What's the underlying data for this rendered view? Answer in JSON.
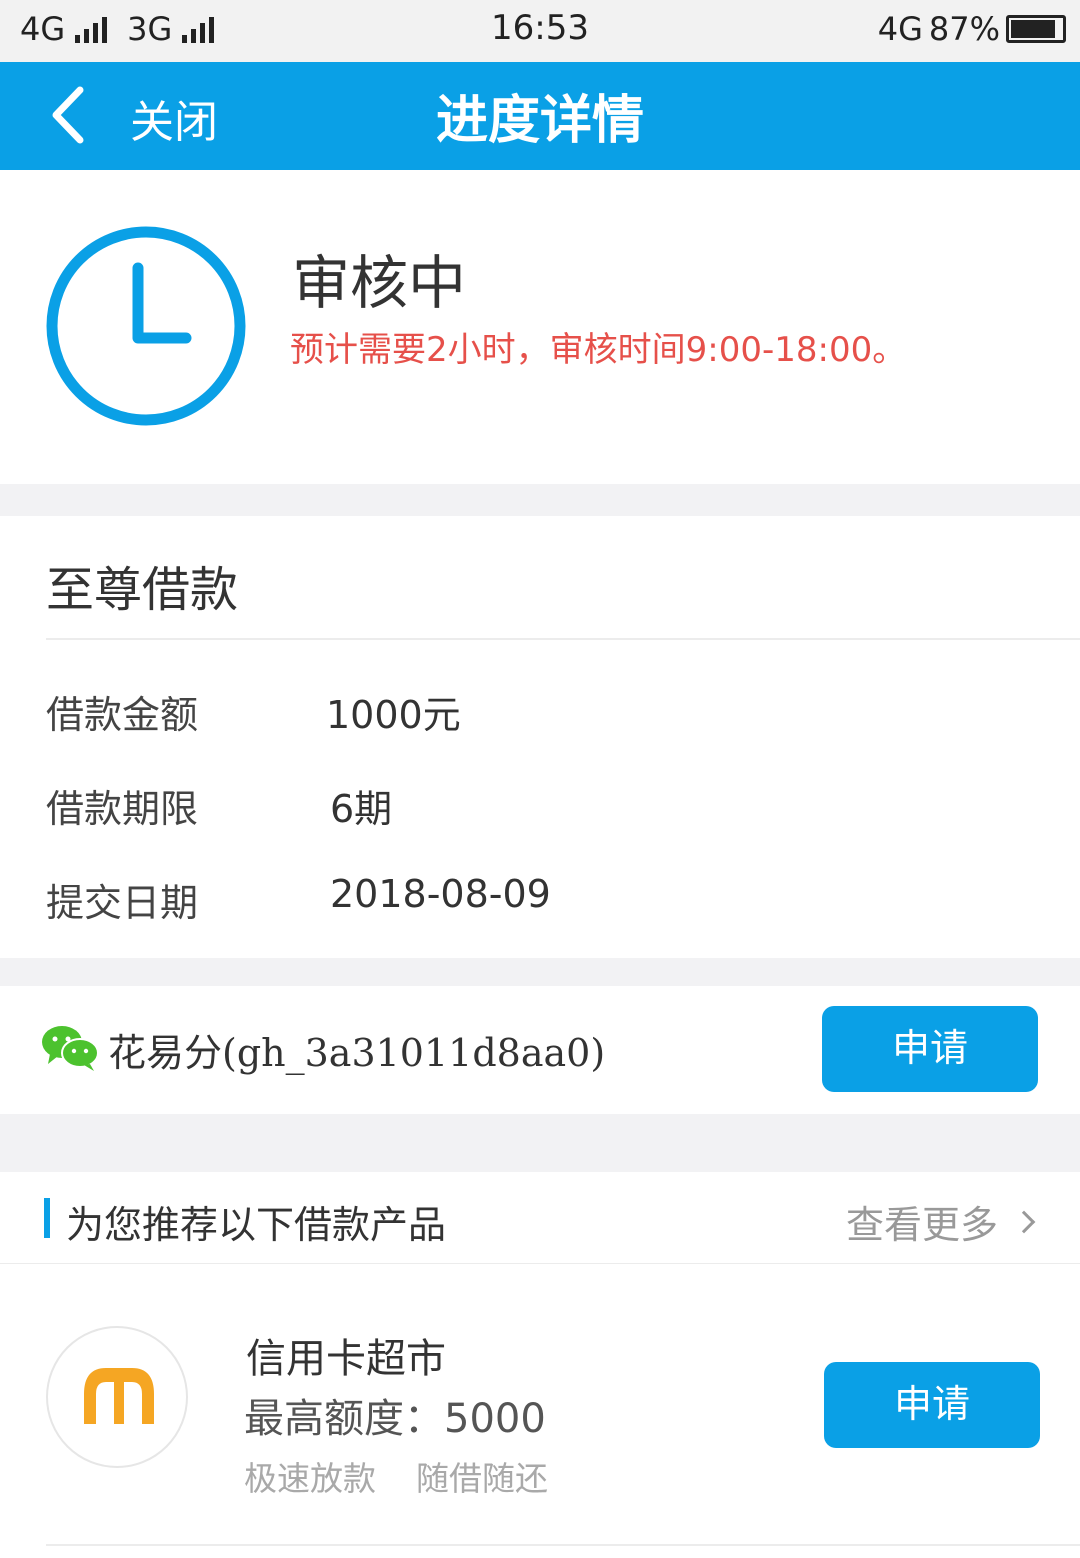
{
  "status_bar": {
    "network1": "4G",
    "network2": "3G",
    "time": "16:53",
    "network3": "4G",
    "battery": "87%",
    "battery_level": 0.87
  },
  "nav": {
    "close_label": "关闭",
    "title": "进度详情"
  },
  "status": {
    "title": "审核中",
    "note": "预计需要2小时，审核时间9:00-18:00。"
  },
  "loan": {
    "title": "至尊借款",
    "rows": [
      {
        "label": "借款金额",
        "value": "1000元"
      },
      {
        "label": "借款期限",
        "value": "6期"
      },
      {
        "label": "提交日期",
        "value": "2018-08-09"
      }
    ]
  },
  "wechat": {
    "account": "花易分(gh_3a31011d8aa0)",
    "apply_label": "申请"
  },
  "recommend": {
    "title": "为您推荐以下借款产品",
    "more_label": "查看更多"
  },
  "product": {
    "name": "信用卡超市",
    "limit": "最高额度：5000",
    "tags": [
      "极速放款",
      "随借随还"
    ],
    "apply_label": "申请"
  },
  "colors": {
    "accent": "#0aa0e6",
    "warning": "#e6504a",
    "logo": "#f5a623",
    "wechat": "#4cc22e"
  }
}
